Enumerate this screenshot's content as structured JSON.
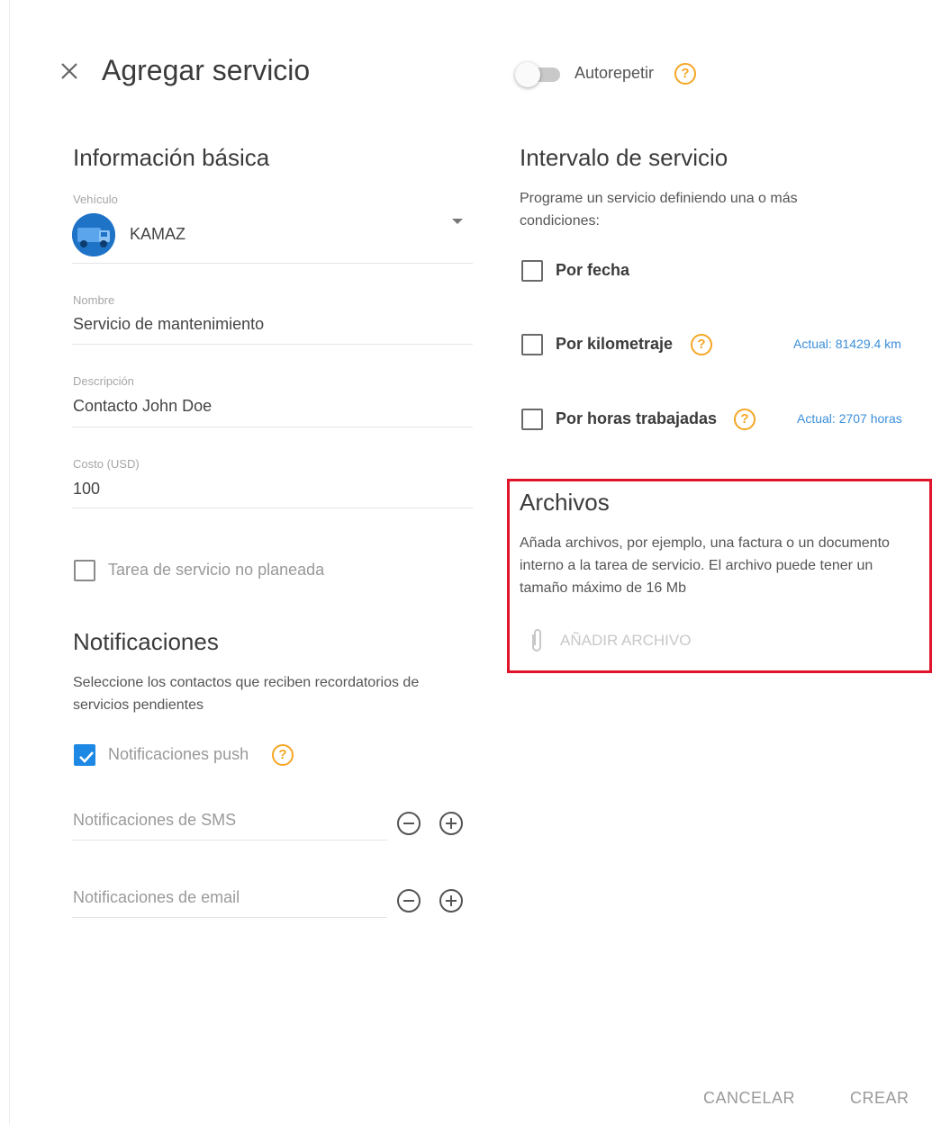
{
  "header": {
    "title": "Agregar servicio",
    "autorepeat_label": "Autorepetir",
    "autorepeat_on": false
  },
  "basic_info": {
    "title": "Información básica",
    "vehicle": {
      "label": "Vehículo",
      "value": "KAMAZ"
    },
    "name": {
      "label": "Nombre",
      "value": "Servicio de mantenimiento"
    },
    "description": {
      "label": "Descripción",
      "value": "Contacto John Doe"
    },
    "cost": {
      "label": "Costo (USD)",
      "value": "100"
    },
    "unplanned_label": "Tarea de servicio no planeada",
    "unplanned_checked": false
  },
  "notifications": {
    "title": "Notificaciones",
    "description": "Seleccione los contactos que reciben recordatorios de servicios pendientes",
    "push_label": "Notificaciones push",
    "push_checked": true,
    "sms_placeholder": "Notificaciones de SMS",
    "email_placeholder": "Notificaciones de email"
  },
  "interval": {
    "title": "Intervalo de servicio",
    "description": "Programe un servicio definiendo una o más condiciones:",
    "by_date_label": "Por fecha",
    "by_km_label": "Por kilometraje",
    "by_km_actual": "Actual: 81429.4 km",
    "by_hours_label": "Por horas trabajadas",
    "by_hours_actual": "Actual: 2707 horas"
  },
  "files": {
    "title": "Archivos",
    "description": "Añada archivos, por ejemplo, una factura o un documento interno a la tarea de servicio. El archivo puede tener un tamaño máximo de 16 Mb",
    "add_label": "AÑADIR ARCHIVO"
  },
  "footer": {
    "cancel_label": "CANCELAR",
    "create_label": "CREAR"
  },
  "colors": {
    "accent": "#1e88e5",
    "help": "#f5a623",
    "link": "#3b8fd9",
    "highlight": "#e0142a"
  },
  "icons": [
    "close-icon",
    "help-icon",
    "chevron-down-icon",
    "truck-icon",
    "check-icon",
    "minus-circle-icon",
    "plus-circle-icon",
    "paperclip-icon"
  ]
}
